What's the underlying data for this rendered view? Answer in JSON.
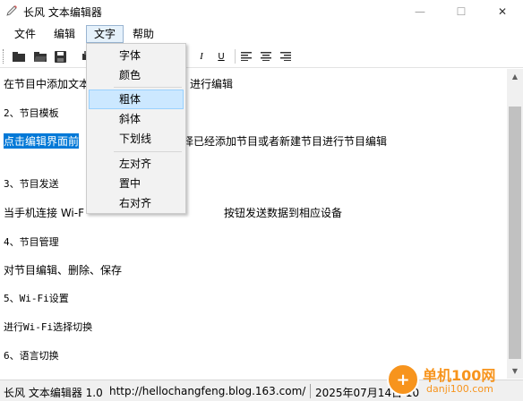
{
  "window": {
    "title": "长风 文本编辑器",
    "buttons": {
      "minimize": "—",
      "maximize": "☐",
      "close": "✕"
    }
  },
  "menubar": {
    "items": [
      "文件",
      "编辑",
      "文字",
      "帮助"
    ],
    "open_index": 2
  },
  "toolbar": {
    "buttons": [
      "new-icon",
      "open-icon",
      "save-icon",
      "print-icon",
      "bold-icon",
      "italic-icon",
      "underline-icon",
      "align-left-icon",
      "align-center-icon",
      "align-right-icon"
    ],
    "glyphs": {
      "italic": "I",
      "underline": "U"
    }
  },
  "editor": {
    "lines": [
      "在节目中添加文本",
      "进行编辑",
      "2、节目模板",
      "点击编辑界面前",
      "择已经添加节目或者新建节目进行节目编辑",
      "3、节目发送",
      "当手机连接 Wi-F",
      "按钮发送数据到相应设备",
      "4、节目管理",
      "对节目编辑、删除、保存",
      "5、Wi-Fi设置",
      "进行Wi-Fi选择切换",
      "6、语言切换"
    ]
  },
  "text_menu": {
    "items": [
      "字体",
      "颜色",
      "粗体",
      "斜体",
      "下划线",
      "左对齐",
      "置中",
      "右对齐"
    ],
    "highlighted": "粗体"
  },
  "statusbar": {
    "app": "长风 文本编辑器 1.0",
    "url": "http://hellochangfeng.blog.163.com/",
    "date": "2025年07月14日 10"
  },
  "watermark": {
    "title": "单机100网",
    "url": "danji100.com"
  },
  "colors": {
    "selection": "#0078d7",
    "menu_highlight": "#cce8ff",
    "accent": "#f7941d"
  }
}
